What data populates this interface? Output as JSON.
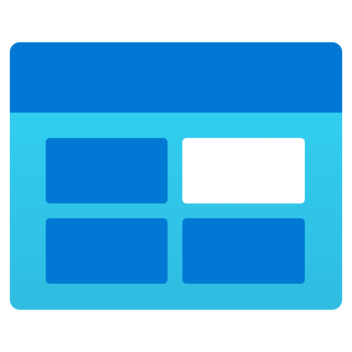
{
  "icon": {
    "name": "storage-table-icon",
    "colors": {
      "header": "#0078D4",
      "body_top": "#32D4F5",
      "body_bottom": "#2FBCE0",
      "cell": "#0078D4",
      "cell_highlight": "#FFFFFF"
    },
    "grid": {
      "rows": 2,
      "columns": 2,
      "highlighted_cell": "top-right"
    }
  }
}
